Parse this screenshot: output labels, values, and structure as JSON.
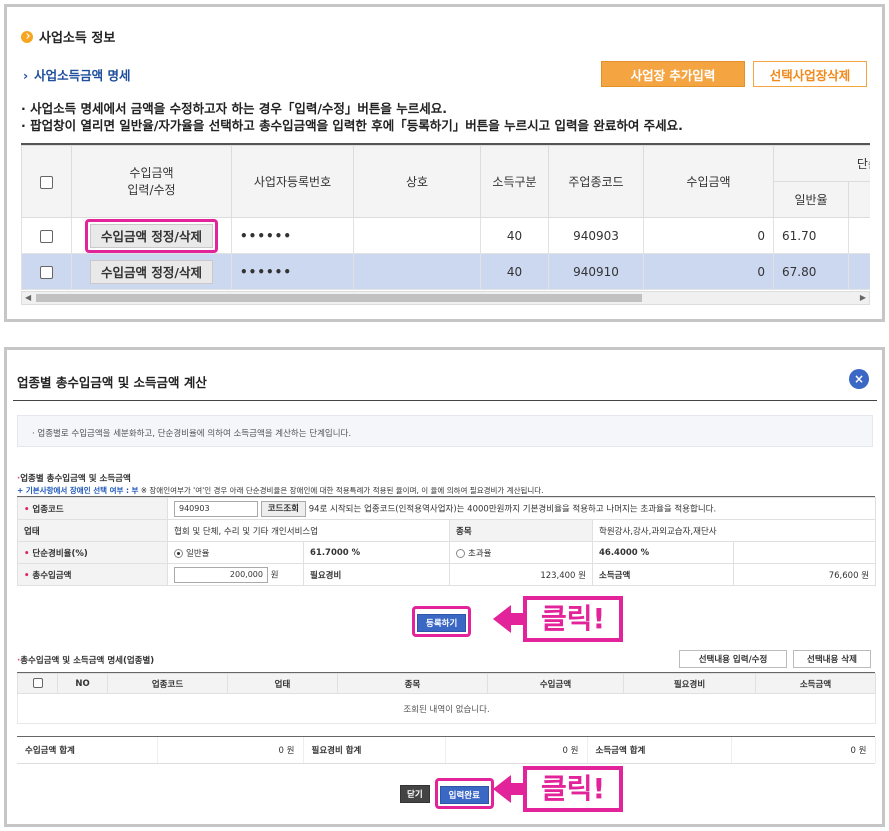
{
  "panel1": {
    "title": "사업소득 정보",
    "subtitle": "사업소득금액 명세",
    "subtitle_arrow": "›",
    "add_button": "사업장 추가입력",
    "delete_button": "선택사업장삭제",
    "note1": "· 사업소득 명세에서 금액을 수정하고자 하는 경우「입력/수정」버튼을 누르세요.",
    "note2": "· 팝업창이 열리면 일반율/자가율을 선택하고 총수입금액을 입력한 후에「등록하기」버튼을 누르시고 입력을 완료하여 주세요.",
    "columns": {
      "income_edit": "수입금액\n입력/수정",
      "biz_no": "사업자등록번호",
      "name": "상호",
      "income_type": "소득구분",
      "industry_code": "주업종코드",
      "income_amount": "수입금액",
      "simple_rate": "단순경비",
      "general_rate": "일반율"
    },
    "rows": [
      {
        "button": "수입금액 정정/삭제",
        "biz_no": "••••••",
        "name": "",
        "type": "40",
        "code": "940903",
        "amount": "0",
        "rate": "61.70"
      },
      {
        "button": "수입금액 정정/삭제",
        "biz_no": "••••••",
        "name": "",
        "type": "40",
        "code": "940910",
        "amount": "0",
        "rate": "67.80"
      }
    ],
    "scroll_left": "◀",
    "scroll_right": "▶"
  },
  "panel2": {
    "title": "업종별 총수입금액 및 소득금액 계산",
    "close_icon": "×",
    "info": "· 업종별로 수입금액을 세분화하고, 단순경비율에 의하여 소득금액을 계산하는 단계입니다.",
    "section1": "업종별 총수입금액 및 소득금액",
    "section_bullet": "·",
    "base_label": "+ 기본사항에서 장애인 선택 여부 :",
    "base_value": "부",
    "base_desc": "※ 장애인여부가 '여'인 경우 아래 단순경비율은 장애인에 대한 적용특례가 적용된 율이며, 이 율에 의하여 필요경비가 계산됩니다.",
    "form": {
      "code_label": "업종코드",
      "code_value": "940903",
      "code_btn": "코드조회",
      "code_note": "94로 시작되는 업종코드(인적용역사업자)는 4000만원까지 기본경비율을 적용하고 나머지는 초과율을 적용합니다.",
      "industry_label": "업태",
      "industry_value": "협회 및 단체, 수리 및 기타 개인서비스업",
      "item_label": "종목",
      "item_value": "학원강사,강사,과외교습자,재단사",
      "rate_label": "단순경비율(%)",
      "general_label": "일반율",
      "general_value": "61.7000 %",
      "excess_label": "초과율",
      "excess_value": "46.4000 %",
      "total_label": "총수입금액",
      "total_value": "200,000",
      "won": "원",
      "expense_label": "필요경비",
      "expense_value": "123,400",
      "income_label": "소득금액",
      "income_value": "76,600",
      "required_mark": "•"
    },
    "register_btn": "등록하기",
    "callout_text": "클릭!",
    "section2": "총수입금액 및 소득금액 명세(업종별)",
    "edit_selected": "선택내용 입력/수정",
    "delete_selected": "선택내용 삭제",
    "list_columns": [
      "NO",
      "업종코드",
      "업태",
      "종목",
      "수입금액",
      "필요경비",
      "소득금액"
    ],
    "empty_msg": "조회된 내역이 없습니다.",
    "totals": {
      "income_label": "수입금액 합계",
      "income_value": "0",
      "expense_label": "필요경비 합계",
      "expense_value": "0",
      "net_label": "소득금액 합계",
      "net_value": "0",
      "won": "원"
    },
    "close_btn": "닫기",
    "done_btn": "입력완료"
  },
  "colors": {
    "highlight": "#e2239a",
    "accent_blue": "#3b67c5",
    "orange": "#f5a442"
  }
}
